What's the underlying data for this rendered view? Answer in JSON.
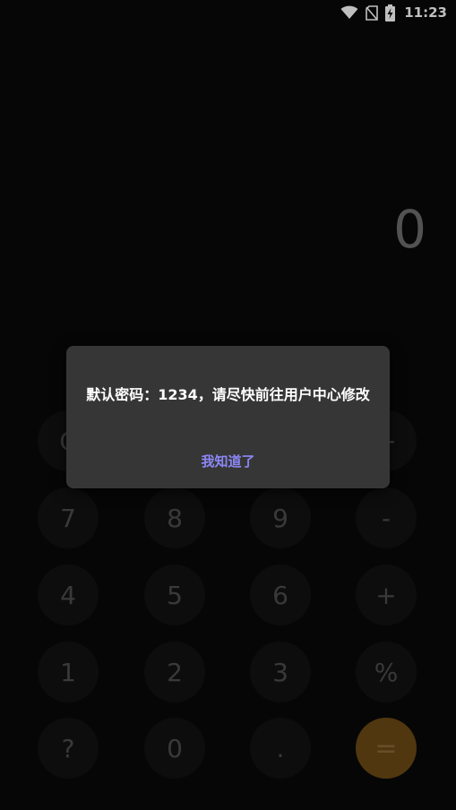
{
  "status_bar": {
    "time": "11:23",
    "icons": [
      "wifi-icon",
      "no-sim-icon",
      "battery-charging-icon"
    ]
  },
  "display": {
    "value": "0"
  },
  "keypad": {
    "row0": [
      "C",
      "÷",
      "×",
      "−"
    ],
    "row1": [
      "7",
      "8",
      "9",
      "-"
    ],
    "row2": [
      "4",
      "5",
      "6",
      "+"
    ],
    "row3": [
      "1",
      "2",
      "3",
      "%"
    ],
    "row4": [
      "?",
      "0",
      ".",
      "="
    ]
  },
  "dialog": {
    "message": "默认密码：1234，请尽快前往用户中心修改",
    "confirm_label": "我知道了"
  },
  "colors": {
    "background": "#080808",
    "key": "#121212",
    "equals_key": "#6b4a14",
    "dialog_bg": "#363636",
    "dialog_button": "#8c87f5"
  }
}
